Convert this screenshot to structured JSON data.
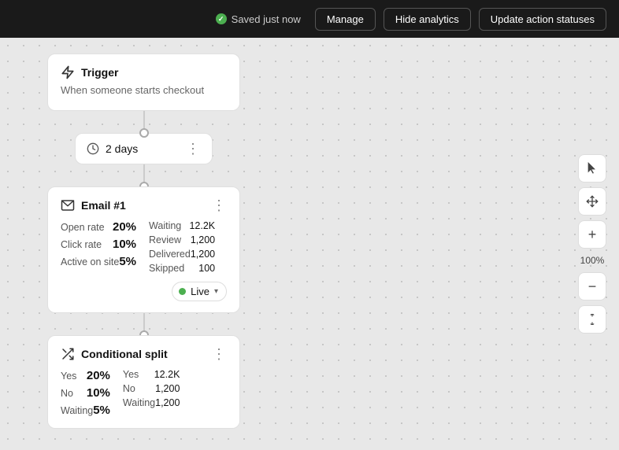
{
  "topbar": {
    "saved_text": "Saved just now",
    "manage_label": "Manage",
    "hide_analytics_label": "Hide analytics",
    "update_action_label": "Update action statuses"
  },
  "trigger_node": {
    "title": "Trigger",
    "subtitle": "When someone starts checkout"
  },
  "delay_node": {
    "label": "2 days"
  },
  "email_node": {
    "title": "Email #1",
    "open_rate_label": "Open rate",
    "open_rate_value": "20%",
    "click_rate_label": "Click rate",
    "click_rate_value": "10%",
    "active_label": "Active on site",
    "active_value": "5%",
    "waiting_label": "Waiting",
    "waiting_value": "12.2K",
    "review_label": "Review",
    "review_value": "1,200",
    "delivered_label": "Delivered",
    "delivered_value": "1,200",
    "skipped_label": "Skipped",
    "skipped_value": "100",
    "status_label": "Live"
  },
  "split_node": {
    "title": "Conditional split",
    "yes_label": "Yes",
    "yes_value": "20%",
    "no_label": "No",
    "no_value": "10%",
    "waiting_label": "Waiting",
    "waiting_value": "5%",
    "yes_count_label": "Yes",
    "yes_count_value": "12.2K",
    "no_count_label": "No",
    "no_count_value": "1,200",
    "waiting_count_label": "Waiting",
    "waiting_count_value": "1,200"
  },
  "toolbar": {
    "zoom_label": "100%",
    "cursor_icon": "▲",
    "move_icon": "✥",
    "plus_icon": "+",
    "minus_icon": "−",
    "up_icon": "↑"
  }
}
